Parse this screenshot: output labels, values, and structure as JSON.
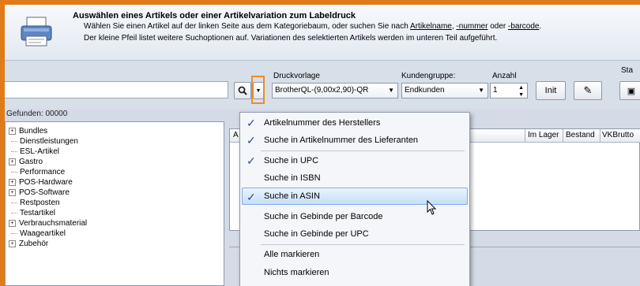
{
  "header": {
    "title": "Auswählen eines Artikels oder einer Artikelvariation zum Labeldruck",
    "line1_a": "Wählen Sie einen Artikel auf der linken Seite aus dem Kategoriebaum, oder suchen Sie nach ",
    "line1_link1": "Artikelname",
    "line1_b": ", ",
    "line1_link2": "-nummer",
    "line1_c": " oder ",
    "line1_link3": "-barcode",
    "line1_d": ".",
    "line2": "Der kleine Pfeil listet weitere Suchoptionen auf. Variationen des selektierten Artikels werden im unteren Teil aufgeführt."
  },
  "toolbar": {
    "search_value": "",
    "found_label": "Gefunden: 00000",
    "druckvorlage_label": "Druckvorlage",
    "druckvorlage_value": "BrotherQL-(9,00x2,90)-QR",
    "kundengruppe_label": "Kundengruppe:",
    "kundengruppe_value": "Endkunden",
    "anzahl_label": "Anzahl",
    "anzahl_value": "1",
    "init_label": "Init",
    "sta_label": "Sta"
  },
  "tree": {
    "items": [
      {
        "label": "Bundles",
        "expandable": true
      },
      {
        "label": "Dienstleistungen",
        "expandable": false
      },
      {
        "label": "ESL-Artikel",
        "expandable": false
      },
      {
        "label": "Gastro",
        "expandable": true
      },
      {
        "label": "Performance",
        "expandable": false
      },
      {
        "label": "POS-Hardware",
        "expandable": true
      },
      {
        "label": "POS-Software",
        "expandable": true
      },
      {
        "label": "Restposten",
        "expandable": false
      },
      {
        "label": "Testartikel",
        "expandable": false
      },
      {
        "label": "Verbrauchsmaterial",
        "expandable": true
      },
      {
        "label": "Waageartikel",
        "expandable": false
      },
      {
        "label": "Zubehör",
        "expandable": true
      }
    ]
  },
  "grid": {
    "columns": [
      "A",
      "Im Lager",
      "Bestand",
      "VKBrutto"
    ]
  },
  "menu": {
    "items": [
      {
        "label": "Artikelnummer des Herstellers",
        "checked": true
      },
      {
        "label": "Suche in Artikelnummer des Lieferanten",
        "checked": true
      },
      {
        "label": "Suche in UPC",
        "checked": true
      },
      {
        "label": "Suche in ISBN",
        "checked": false
      },
      {
        "label": "Suche in ASIN",
        "checked": true
      },
      {
        "label": "Suche in Gebinde per Barcode",
        "checked": false
      },
      {
        "label": "Suche in Gebinde per UPC",
        "checked": false
      },
      {
        "label": "Alle markieren",
        "checked": false
      },
      {
        "label": "Nichts markieren",
        "checked": false
      }
    ],
    "selected": "Suche in ASIN"
  },
  "colors": {
    "accent_border": "#f08c23",
    "window_frame": "#e07b1a",
    "check": "#2a4f8a"
  }
}
